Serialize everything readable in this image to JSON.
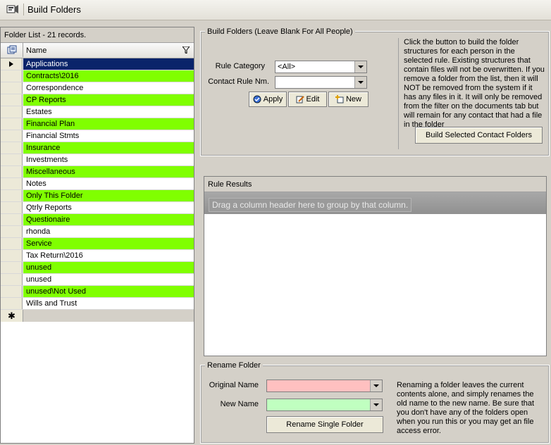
{
  "window": {
    "title": "Build Folders"
  },
  "folder_list": {
    "header": "Folder List - 21 records.",
    "column_name": "Name",
    "rows": [
      {
        "name": "Applications",
        "state": "selected"
      },
      {
        "name": "Contracts\\2016",
        "state": "green"
      },
      {
        "name": "Correspondence",
        "state": "normal"
      },
      {
        "name": "CP Reports",
        "state": "green"
      },
      {
        "name": "Estates",
        "state": "normal"
      },
      {
        "name": "Financial Plan",
        "state": "green"
      },
      {
        "name": "Financial Stmts",
        "state": "normal"
      },
      {
        "name": "Insurance",
        "state": "green"
      },
      {
        "name": "Investments",
        "state": "normal"
      },
      {
        "name": "Miscellaneous",
        "state": "green"
      },
      {
        "name": "Notes",
        "state": "normal"
      },
      {
        "name": "Only This Folder",
        "state": "green"
      },
      {
        "name": "Qtrly Reports",
        "state": "normal"
      },
      {
        "name": "Questionaire",
        "state": "green"
      },
      {
        "name": "rhonda",
        "state": "normal"
      },
      {
        "name": "Service",
        "state": "green"
      },
      {
        "name": "Tax Return\\2016",
        "state": "normal"
      },
      {
        "name": "unused",
        "state": "green"
      },
      {
        "name": "unused",
        "state": "normal"
      },
      {
        "name": "unused\\Not Used",
        "state": "green"
      },
      {
        "name": "Wills and Trust",
        "state": "normal"
      }
    ],
    "new_row_marker": "✱"
  },
  "build_folders": {
    "group_title": "Build Folders (Leave Blank For All People)",
    "rule_category_label": "Rule Category",
    "rule_category_value": "<All>",
    "contact_rule_label": "Contact Rule Nm.",
    "contact_rule_value": "",
    "apply_label": "Apply",
    "edit_label": "Edit",
    "new_label": "New",
    "help_text": "Click the button to build the folder structures for each person in the selected rule.  Existing structures that contain files will not be overwritten.  If you remove a folder from the list, then it will NOT be removed from the system if it has any files in it.  It will only be removed from the filter on the documents tab but will remain for any contact that had a file in the folder",
    "build_button_label": "Build Selected Contact Folders"
  },
  "rule_results": {
    "header": "Rule Results",
    "group_panel_hint": "Drag a column header here to group by that column."
  },
  "rename_folder": {
    "group_title": "Rename Folder",
    "original_name_label": "Original Name",
    "original_name_value": "",
    "new_name_label": "New Name",
    "new_name_value": "",
    "rename_button_label": "Rename Single Folder",
    "help_text": "Renaming a folder leaves the current contents alone, and simply renames the old name to the new name.  Be sure that you don't have any of the folders open when you run this or you may get an file access error."
  },
  "colors": {
    "highlight_green": "#80ff00",
    "selected_row": "#0a246a",
    "original_name_bg": "#ffc0c0",
    "new_name_bg": "#c0ffc0"
  }
}
